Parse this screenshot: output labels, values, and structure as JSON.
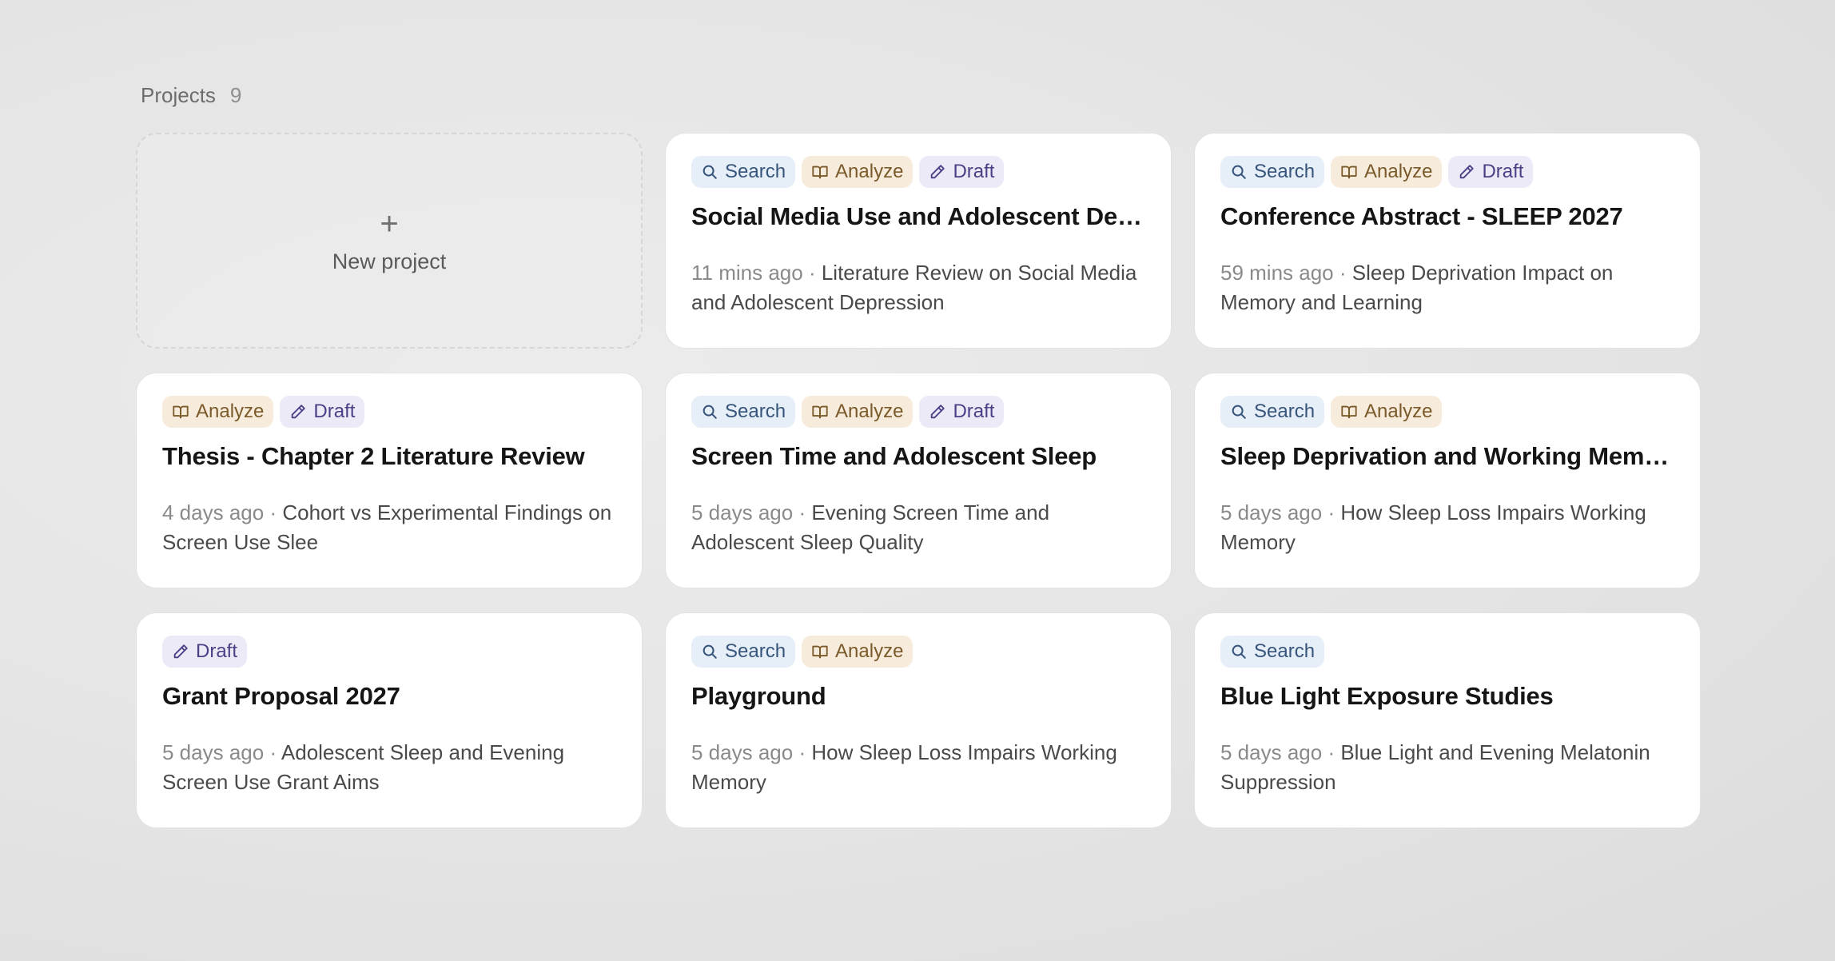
{
  "section": {
    "title": "Projects",
    "count": "9"
  },
  "new_project": {
    "icon": "plus-icon",
    "label": "New project"
  },
  "tag_styles": {
    "Search": {
      "icon": "search-icon",
      "bg": "#e6eef8",
      "fg": "#37557a"
    },
    "Analyze": {
      "icon": "book-icon",
      "bg": "#f7ecdc",
      "fg": "#7a5a2a"
    },
    "Draft": {
      "icon": "pencil-icon",
      "bg": "#eceaf7",
      "fg": "#4d3f86"
    }
  },
  "projects": [
    {
      "tags": [
        "Search",
        "Analyze",
        "Draft"
      ],
      "title": "Social Media Use and Adolescent Depression",
      "time": "11 mins ago",
      "description": "Literature Review on Social Media and Adolescent Depression"
    },
    {
      "tags": [
        "Search",
        "Analyze",
        "Draft"
      ],
      "title": "Conference Abstract - SLEEP 2027",
      "time": "59 mins ago",
      "description": "Sleep Deprivation Impact on Memory and Learning"
    },
    {
      "tags": [
        "Analyze",
        "Draft"
      ],
      "title": "Thesis - Chapter 2 Literature Review",
      "time": "4 days ago",
      "description": "Cohort vs Experimental Findings on Screen Use Slee"
    },
    {
      "tags": [
        "Search",
        "Analyze",
        "Draft"
      ],
      "title": "Screen Time and Adolescent Sleep",
      "time": "5 days ago",
      "description": "Evening Screen Time and Adolescent Sleep Quality"
    },
    {
      "tags": [
        "Search",
        "Analyze"
      ],
      "title": "Sleep Deprivation and Working Memory",
      "time": "5 days ago",
      "description": "How Sleep Loss Impairs Working Memory"
    },
    {
      "tags": [
        "Draft"
      ],
      "title": "Grant Proposal 2027",
      "time": "5 days ago",
      "description": "Adolescent Sleep and Evening Screen Use Grant Aims"
    },
    {
      "tags": [
        "Search",
        "Analyze"
      ],
      "title": "Playground",
      "time": "5 days ago",
      "description": "How Sleep Loss Impairs Working Memory"
    },
    {
      "tags": [
        "Search"
      ],
      "title": "Blue Light Exposure Studies",
      "time": "5 days ago",
      "description": "Blue Light and Evening Melatonin Suppression"
    }
  ]
}
